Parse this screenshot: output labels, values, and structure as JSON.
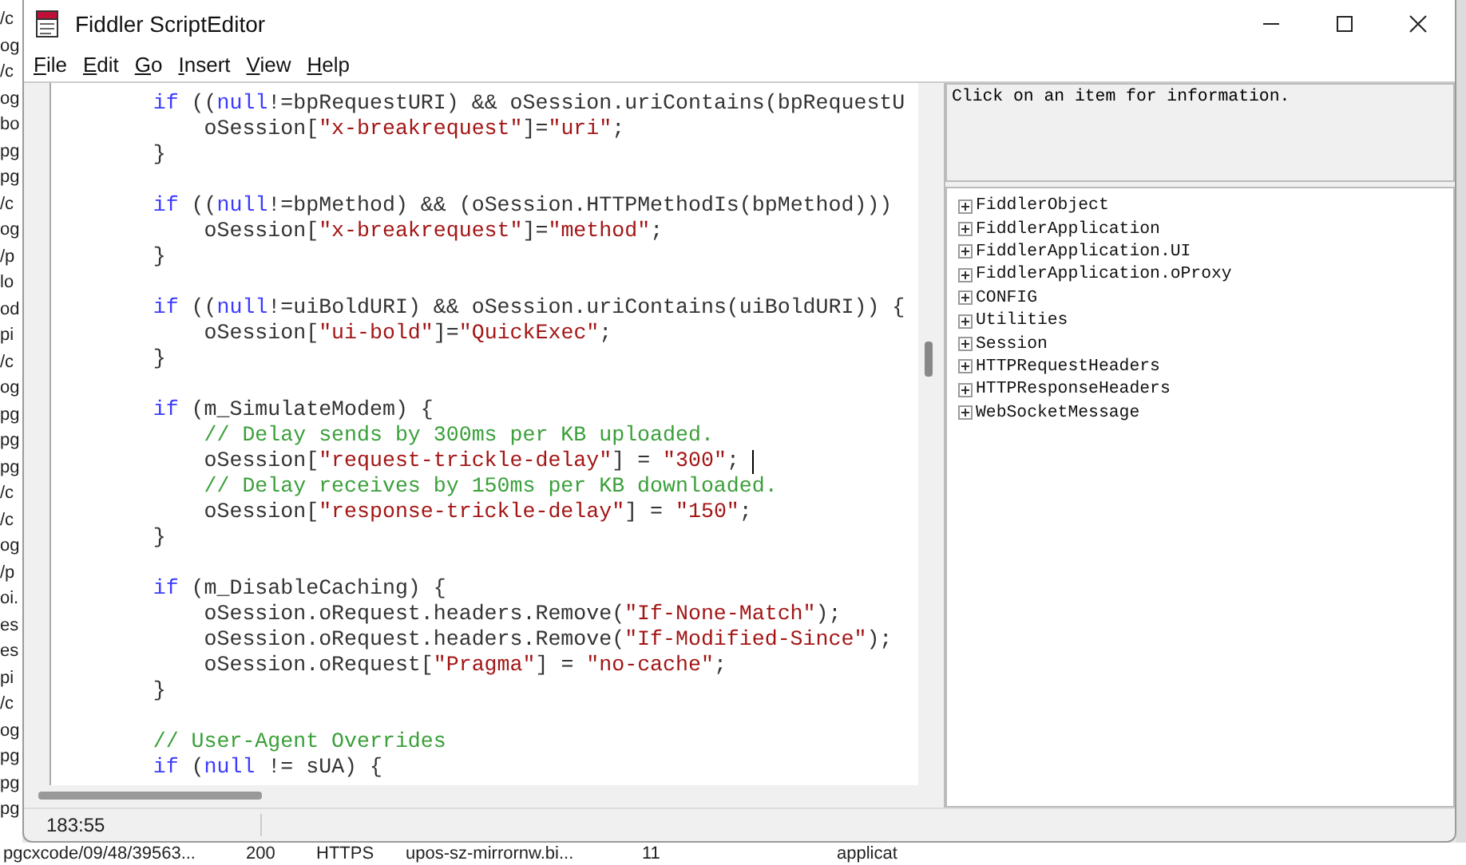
{
  "background": {
    "session_fragments": [
      "/c",
      "og",
      "/c",
      "og",
      "bo",
      "pg",
      "pg",
      "/c",
      "og",
      "/p",
      "lo",
      "od",
      "pi",
      "/c",
      "og",
      "pg",
      "pg",
      "pg",
      "/c",
      "/c",
      "og",
      "/p",
      "oi.",
      "es",
      "es",
      "pi",
      "/c",
      "og",
      "pg",
      "pg",
      "pg"
    ],
    "session_row": [
      "pgcxcode/09/48/39563...",
      "200",
      "HTTPS",
      "upos-sz-mirrornw.bi...",
      "11",
      "applicat"
    ]
  },
  "window": {
    "title": "Fiddler ScriptEditor"
  },
  "menu": [
    "File",
    "Edit",
    "Go",
    "Insert",
    "View",
    "Help"
  ],
  "editor": {
    "lines": [
      {
        "kind": "code",
        "tokens": [
          {
            "kind": "keyword",
            "text": "        if"
          },
          {
            "kind": "plain",
            "text": " (("
          },
          {
            "kind": "keyword",
            "text": "null"
          },
          {
            "kind": "plain",
            "text": "!=bpRequestURI) && oSession.uriContains(bpRequestU"
          }
        ]
      },
      {
        "kind": "code",
        "tokens": [
          {
            "kind": "plain",
            "text": "            oSession["
          },
          {
            "kind": "string",
            "text": "\"x-breakrequest\""
          },
          {
            "kind": "plain",
            "text": "]="
          },
          {
            "kind": "string",
            "text": "\"uri\""
          },
          {
            "kind": "plain",
            "text": ";"
          }
        ]
      },
      {
        "kind": "code",
        "tokens": [
          {
            "kind": "plain",
            "text": "        }"
          }
        ]
      },
      {
        "kind": "blank"
      },
      {
        "kind": "code",
        "tokens": [
          {
            "kind": "keyword",
            "text": "        if"
          },
          {
            "kind": "plain",
            "text": " (("
          },
          {
            "kind": "keyword",
            "text": "null"
          },
          {
            "kind": "plain",
            "text": "!=bpMethod) && (oSession.HTTPMethodIs(bpMethod)))"
          }
        ]
      },
      {
        "kind": "code",
        "tokens": [
          {
            "kind": "plain",
            "text": "            oSession["
          },
          {
            "kind": "string",
            "text": "\"x-breakrequest\""
          },
          {
            "kind": "plain",
            "text": "]="
          },
          {
            "kind": "string",
            "text": "\"method\""
          },
          {
            "kind": "plain",
            "text": ";"
          }
        ]
      },
      {
        "kind": "code",
        "tokens": [
          {
            "kind": "plain",
            "text": "        }"
          }
        ]
      },
      {
        "kind": "blank"
      },
      {
        "kind": "code",
        "tokens": [
          {
            "kind": "keyword",
            "text": "        if"
          },
          {
            "kind": "plain",
            "text": " (("
          },
          {
            "kind": "keyword",
            "text": "null"
          },
          {
            "kind": "plain",
            "text": "!=uiBoldURI) && oSession.uriContains(uiBoldURI)) {"
          }
        ]
      },
      {
        "kind": "code",
        "tokens": [
          {
            "kind": "plain",
            "text": "            oSession["
          },
          {
            "kind": "string",
            "text": "\"ui-bold\""
          },
          {
            "kind": "plain",
            "text": "]="
          },
          {
            "kind": "string",
            "text": "\"QuickExec\""
          },
          {
            "kind": "plain",
            "text": ";"
          }
        ]
      },
      {
        "kind": "code",
        "tokens": [
          {
            "kind": "plain",
            "text": "        }"
          }
        ]
      },
      {
        "kind": "blank"
      },
      {
        "kind": "code",
        "tokens": [
          {
            "kind": "keyword",
            "text": "        if"
          },
          {
            "kind": "plain",
            "text": " (m_SimulateModem) {"
          }
        ]
      },
      {
        "kind": "code",
        "tokens": [
          {
            "kind": "comment",
            "text": "            // Delay sends by 300ms per KB uploaded."
          }
        ]
      },
      {
        "kind": "code",
        "cursor": true,
        "tokens": [
          {
            "kind": "plain",
            "text": "            oSession["
          },
          {
            "kind": "string",
            "text": "\"request-trickle-delay\""
          },
          {
            "kind": "plain",
            "text": "] = "
          },
          {
            "kind": "string",
            "text": "\"300\""
          },
          {
            "kind": "plain",
            "text": ";"
          }
        ]
      },
      {
        "kind": "code",
        "tokens": [
          {
            "kind": "comment",
            "text": "            // Delay receives by 150ms per KB downloaded."
          }
        ]
      },
      {
        "kind": "code",
        "tokens": [
          {
            "kind": "plain",
            "text": "            oSession["
          },
          {
            "kind": "string",
            "text": "\"response-trickle-delay\""
          },
          {
            "kind": "plain",
            "text": "] = "
          },
          {
            "kind": "string",
            "text": "\"150\""
          },
          {
            "kind": "plain",
            "text": ";"
          }
        ]
      },
      {
        "kind": "code",
        "tokens": [
          {
            "kind": "plain",
            "text": "        }"
          }
        ]
      },
      {
        "kind": "blank"
      },
      {
        "kind": "code",
        "tokens": [
          {
            "kind": "keyword",
            "text": "        if"
          },
          {
            "kind": "plain",
            "text": " (m_DisableCaching) {"
          }
        ]
      },
      {
        "kind": "code",
        "tokens": [
          {
            "kind": "plain",
            "text": "            oSession.oRequest.headers.Remove("
          },
          {
            "kind": "string",
            "text": "\"If-None-Match\""
          },
          {
            "kind": "plain",
            "text": ");"
          }
        ]
      },
      {
        "kind": "code",
        "tokens": [
          {
            "kind": "plain",
            "text": "            oSession.oRequest.headers.Remove("
          },
          {
            "kind": "string",
            "text": "\"If-Modified-Since\""
          },
          {
            "kind": "plain",
            "text": ");"
          }
        ]
      },
      {
        "kind": "code",
        "tokens": [
          {
            "kind": "plain",
            "text": "            oSession.oRequest["
          },
          {
            "kind": "string",
            "text": "\"Pragma\""
          },
          {
            "kind": "plain",
            "text": "] = "
          },
          {
            "kind": "string",
            "text": "\"no-cache\""
          },
          {
            "kind": "plain",
            "text": ";"
          }
        ]
      },
      {
        "kind": "code",
        "tokens": [
          {
            "kind": "plain",
            "text": "        }"
          }
        ]
      },
      {
        "kind": "blank"
      },
      {
        "kind": "code",
        "tokens": [
          {
            "kind": "comment",
            "text": "        // User-Agent Overrides"
          }
        ]
      },
      {
        "kind": "code",
        "tokens": [
          {
            "kind": "keyword",
            "text": "        if"
          },
          {
            "kind": "plain",
            "text": " ("
          },
          {
            "kind": "keyword",
            "text": "null"
          },
          {
            "kind": "plain",
            "text": " != sUA) {"
          }
        ]
      }
    ]
  },
  "info": {
    "text": "Click on an item for information."
  },
  "object_tree": [
    {
      "label": "FiddlerObject",
      "expanded": false
    },
    {
      "label": "FiddlerApplication",
      "expanded": false
    },
    {
      "label": "FiddlerApplication.UI",
      "expanded": false
    },
    {
      "label": "FiddlerApplication.oProxy",
      "expanded": false
    },
    {
      "label": "CONFIG",
      "expanded": false
    },
    {
      "label": "Utilities",
      "expanded": false
    },
    {
      "label": "Session",
      "expanded": false
    },
    {
      "label": "HTTPRequestHeaders",
      "expanded": false
    },
    {
      "label": "HTTPResponseHeaders",
      "expanded": false
    },
    {
      "label": "WebSocketMessage",
      "expanded": false
    }
  ],
  "status_bar": {
    "position": "183:55"
  }
}
